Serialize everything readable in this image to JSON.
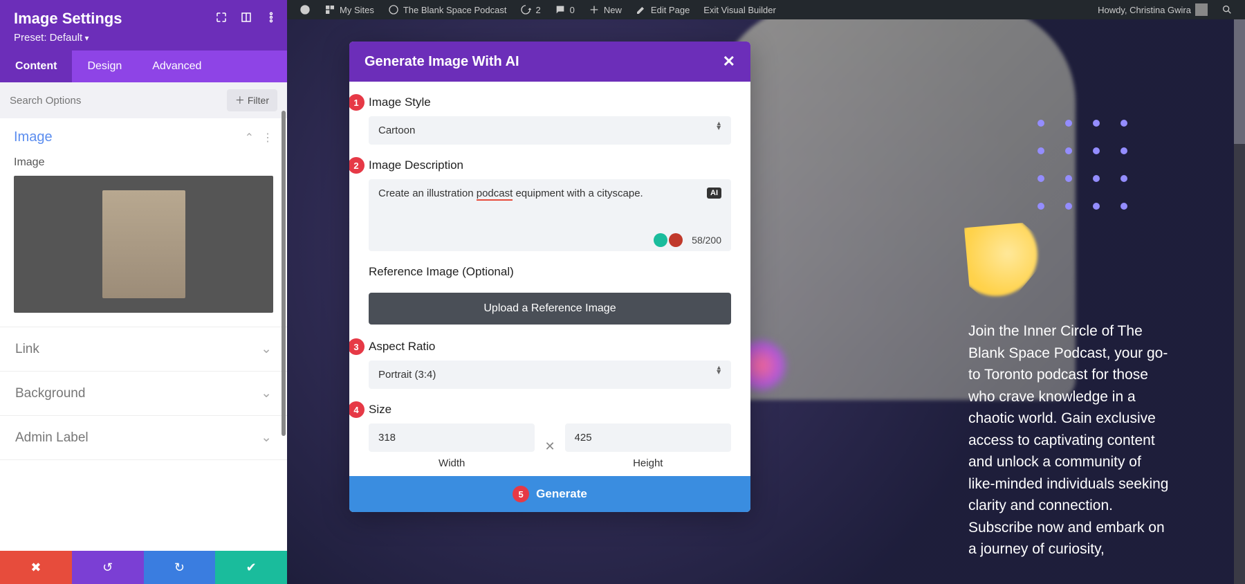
{
  "adminbar": {
    "my_sites": "My Sites",
    "site_name": "The Blank Space Podcast",
    "updates": "2",
    "comments": "0",
    "new": "New",
    "edit_page": "Edit Page",
    "exit_builder": "Exit Visual Builder",
    "greeting": "Howdy, Christina Gwira"
  },
  "sidebar": {
    "title": "Image Settings",
    "preset": "Preset: Default",
    "tabs": {
      "content": "Content",
      "design": "Design",
      "advanced": "Advanced"
    },
    "search_placeholder": "Search Options",
    "filter": "Filter",
    "group_image": "Image",
    "field_image": "Image",
    "accordion": {
      "link": "Link",
      "background": "Background",
      "admin_label": "Admin Label"
    }
  },
  "modal": {
    "title": "Generate Image With AI",
    "style_label": "Image Style",
    "style_value": "Cartoon",
    "desc_label": "Image Description",
    "desc_value_pre": "Create an illustration ",
    "desc_value_spell": "podcast",
    "desc_value_post": " equipment with a cityscape.",
    "ai_tag": "AI",
    "char_count": "58/200",
    "ref_label": "Reference Image (Optional)",
    "upload": "Upload a Reference Image",
    "aspect_label": "Aspect Ratio",
    "aspect_value": "Portrait (3:4)",
    "size_label": "Size",
    "width": "318",
    "height": "425",
    "width_lbl": "Width",
    "height_lbl": "Height",
    "generate": "Generate",
    "badges": [
      "1",
      "2",
      "3",
      "4",
      "5"
    ]
  },
  "page": {
    "body_text": "Join the Inner Circle of The Blank Space Podcast, your go-to Toronto podcast for those who crave knowledge in a chaotic world. Gain exclusive access to captivating content and unlock a community of like-minded individuals seeking clarity and connection. Subscribe now and embark on a journey of curiosity,"
  }
}
